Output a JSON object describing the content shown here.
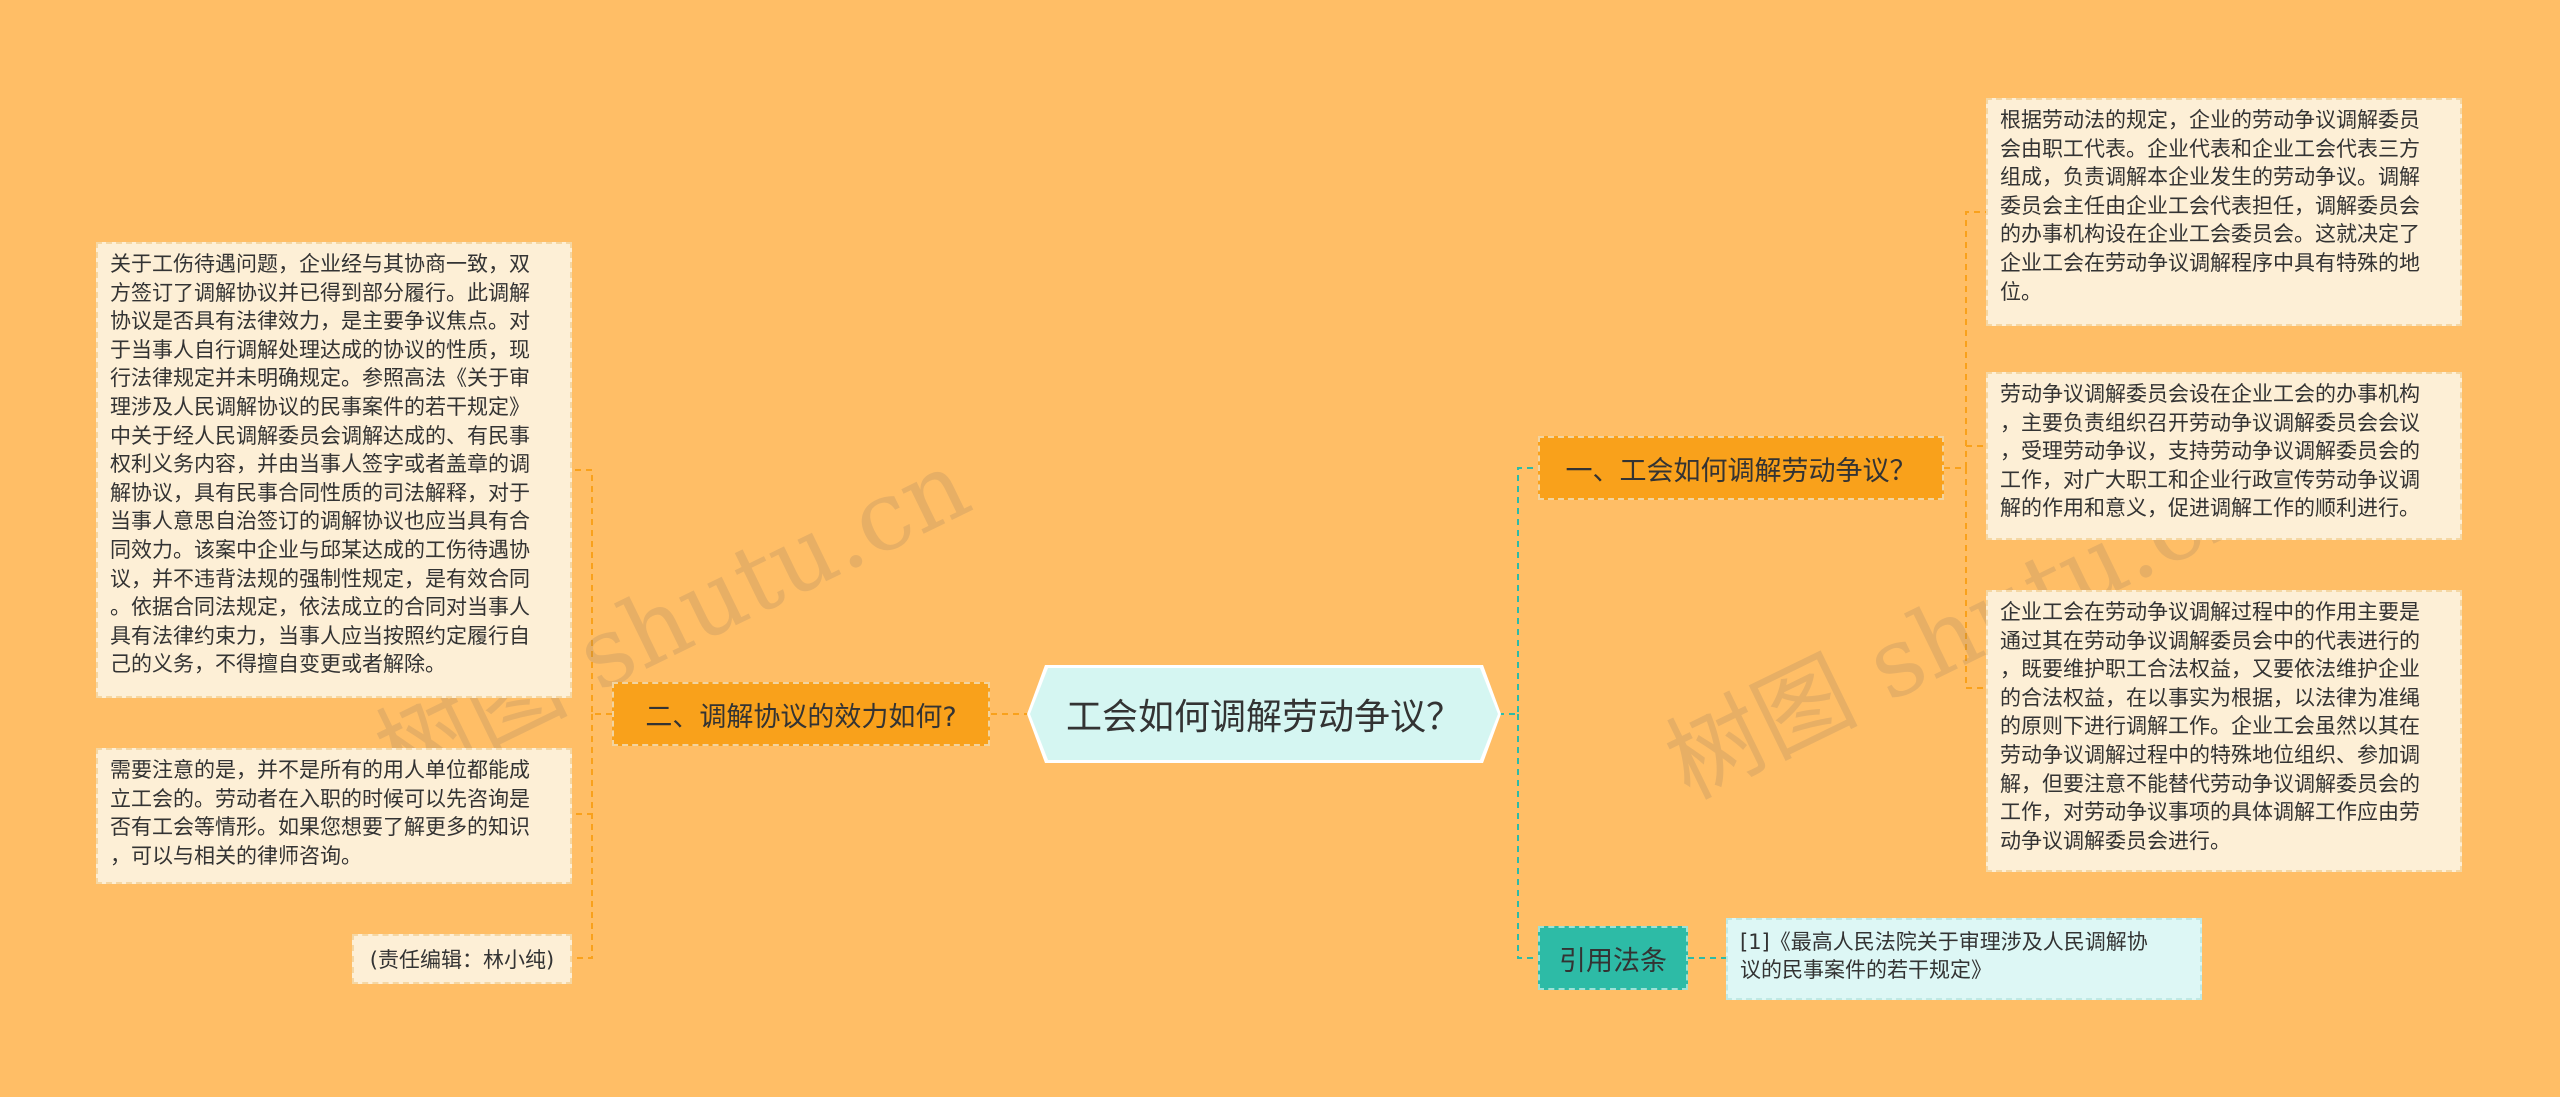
{
  "center": {
    "title": "工会如何调解劳动争议？"
  },
  "right_branch": {
    "label": "一、工会如何调解劳动争议？",
    "paragraphs": [
      "根据劳动法的规定，企业的劳动争议调解委员\n会由职工代表。企业代表和企业工会代表三方\n组成，负责调解本企业发生的劳动争议。调解\n委员会主任由企业工会代表担任，调解委员会\n的办事机构设在企业工会委员会。这就决定了\n企业工会在劳动争议调解程序中具有特殊的地\n位。",
      "劳动争议调解委员会设在企业工会的办事机构\n，主要负责组织召开劳动争议调解委员会会议\n，受理劳动争议，支持劳动争议调解委员会的\n工作，对广大职工和企业行政宣传劳动争议调\n解的作用和意义，促进调解工作的顺利进行。",
      "企业工会在劳动争议调解过程中的作用主要是\n通过其在劳动争议调解委员会中的代表进行的\n，既要维护职工合法权益，又要依法维护企业\n的合法权益，在以事实为根据，以法律为准绳\n的原则下进行调解工作。企业工会虽然以其在\n劳动争议调解过程中的特殊地位组织、参加调\n解，但要注意不能替代劳动争议调解委员会的\n工作，对劳动争议事项的具体调解工作应由劳\n动争议调解委员会进行。"
    ]
  },
  "law_branch": {
    "label": "引用法条",
    "citation": "[1]《最高人民法院关于审理涉及人民调解协\n议的民事案件的若干规定》"
  },
  "left_branch": {
    "label": "二、调解协议的效力如何?",
    "paragraphs": [
      "关于工伤待遇问题，企业经与其协商一致，双\n方签订了调解协议并已得到部分履行。此调解\n协议是否具有法律效力，是主要争议焦点。对\n于当事人自行调解处理达成的协议的性质，现\n行法律规定并未明确规定。参照高法《关于审\n理涉及人民调解协议的民事案件的若干规定》\n中关于经人民调解委员会调解达成的、有民事\n权利义务内容，并由当事人签字或者盖章的调\n解协议，具有民事合同性质的司法解释，对于\n当事人意思自治签订的调解协议也应当具有合\n同效力。该案中企业与邱某达成的工伤待遇协\n议，并不违背法规的强制性规定，是有效合同\n。依据合同法规定，依法成立的合同对当事人\n具有法律约束力，当事人应当按照约定履行自\n己的义务，不得擅自变更或者解除。",
      "需要注意的是，并不是所有的用人单位都能成\n立工会的。劳动者在入职的时候可以先咨询是\n否有工会等情形。如果您想要了解更多的知识\n，可以与相关的律师咨询。"
    ],
    "editor": "(责任编辑：林小纯)"
  },
  "watermarks": [
    "树图 shutu.cn",
    "树图 shutu.cn"
  ],
  "colors": {
    "background": "#FFBE66",
    "center": "#D5F6F2",
    "branch_orange": "#F9A11B",
    "branch_teal": "#2DBBA6",
    "leaf": "#FDEFD6",
    "leaf_blue": "#DDF7F5",
    "connector_orange": "#F9A11B",
    "connector_teal": "#2DBBA6"
  }
}
